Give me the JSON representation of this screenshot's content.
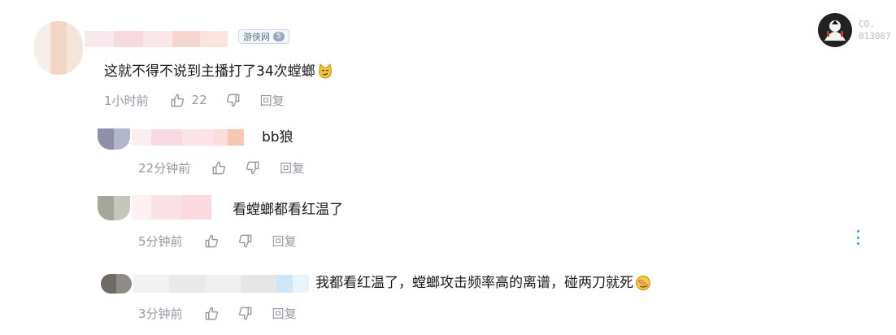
{
  "current_user": {
    "id_line1": "CO.",
    "id_line2": "013067"
  },
  "badge": {
    "site": "游侠网",
    "level": "5"
  },
  "comments": [
    {
      "text": "这就不得不说到主播打了34次螳螂",
      "emoji": "smug-cat-emoji",
      "time": "1小时前",
      "likes": "22",
      "reply": "回复"
    }
  ],
  "replies": [
    {
      "text": "bb狼",
      "time": "22分钟前",
      "reply": "回复"
    },
    {
      "text": "看螳螂都看红温了",
      "time": "5分钟前",
      "reply": "回复"
    },
    {
      "text": "我都看红温了，螳螂攻击频率高的离谱，碰两刀就死",
      "emoji": "facepalm-emoji",
      "time": "3分钟前",
      "reply": "回复"
    }
  ],
  "colors": {
    "reply_text": "#9499a0",
    "more_icon": "#2e9be6"
  }
}
